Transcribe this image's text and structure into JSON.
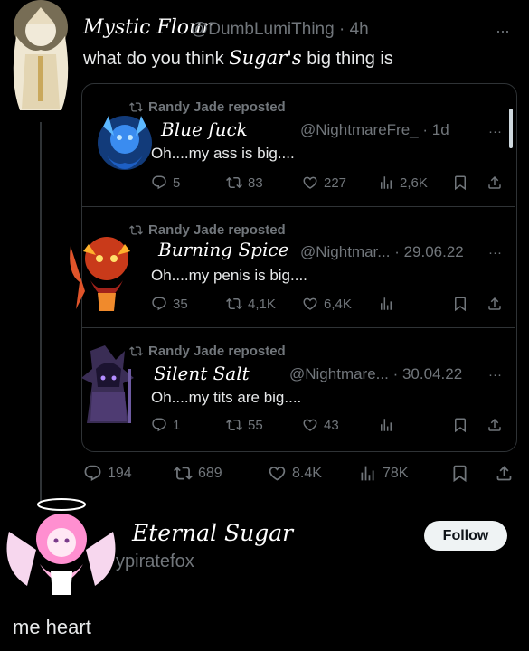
{
  "main_post": {
    "display_name": "Mystic Flour",
    "handle": "@DumbLumiThing",
    "time": "· 4h",
    "text_before": "what do you think",
    "text_name": "Sugar's",
    "text_after": "big thing is",
    "more": "···"
  },
  "quoted": [
    {
      "repost_label": "Randy Jade reposted",
      "name": "Blue fuck",
      "handle": "@NightmareFre_",
      "time": "· 1d",
      "text": "Oh....my ass is big....",
      "replies": "5",
      "reposts": "83",
      "likes": "227",
      "views": "2,6K"
    },
    {
      "repost_label": "Randy Jade reposted",
      "name": "Burning Spice",
      "handle": "@Nightmar...",
      "time": "· 29.06.22",
      "text": "Oh....my penis is big....",
      "replies": "35",
      "reposts": "4,1K",
      "likes": "6,4K",
      "views": ""
    },
    {
      "repost_label": "Randy Jade reposted",
      "name": "Silent Salt",
      "handle": "@Nightmare...",
      "time": "· 30.04.22",
      "text": "Oh....my tits are big....",
      "replies": "1",
      "reposts": "55",
      "likes": "43",
      "views": ""
    }
  ],
  "main_stats": {
    "replies": "194",
    "reposts": "689",
    "likes": "8.4K",
    "views": "78K"
  },
  "reply": {
    "display_name": "Eternal Sugar",
    "handle": "ypiratefox",
    "follow_label": "Follow",
    "text": "me heart"
  },
  "more_glyph": "···",
  "colors": {
    "background": "#000000",
    "text": "#e7e9ea",
    "secondary": "#71767b",
    "border": "#2f3336",
    "follow_bg": "#eff3f4"
  }
}
